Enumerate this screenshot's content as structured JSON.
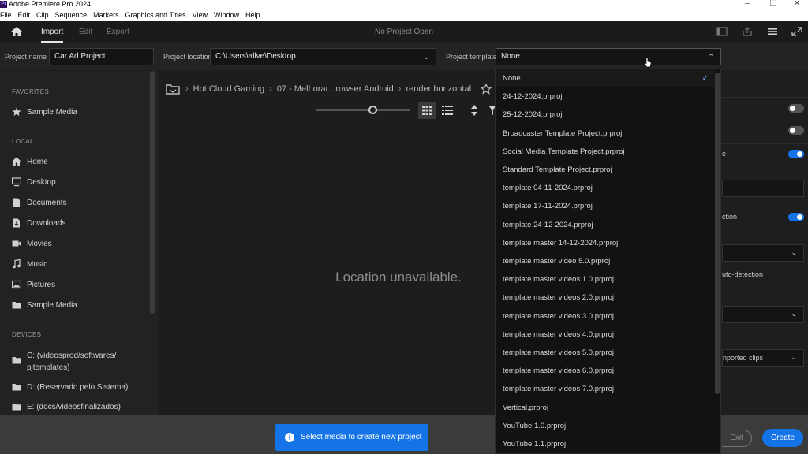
{
  "window": {
    "title": "Adobe Premiere Pro 2024",
    "logo_text": "Pr"
  },
  "menu": [
    "File",
    "Edit",
    "Clip",
    "Sequence",
    "Markers",
    "Graphics and Titles",
    "View",
    "Window",
    "Help"
  ],
  "nav": {
    "tabs": [
      "Import",
      "Edit",
      "Export"
    ],
    "active_tab": "Import",
    "center_text": "No Project Open"
  },
  "settings": {
    "project_name_label": "Project name",
    "project_name_value": "Car Ad Project",
    "project_location_label": "Project location",
    "project_location_value": "C:\\Users\\allve\\Desktop",
    "project_template_label": "Project template",
    "project_template_value": "None"
  },
  "sidebar": {
    "favorites_header": "FAVORITES",
    "favorites": [
      {
        "label": "Sample Media",
        "icon": "star-icon"
      }
    ],
    "local_header": "LOCAL",
    "local": [
      {
        "label": "Home",
        "icon": "home-icon"
      },
      {
        "label": "Desktop",
        "icon": "monitor-icon"
      },
      {
        "label": "Documents",
        "icon": "document-icon"
      },
      {
        "label": "Downloads",
        "icon": "download-icon"
      },
      {
        "label": "Movies",
        "icon": "film-icon"
      },
      {
        "label": "Music",
        "icon": "music-icon"
      },
      {
        "label": "Pictures",
        "icon": "image-icon"
      },
      {
        "label": "Sample Media",
        "icon": "folder-icon"
      }
    ],
    "devices_header": "DEVICES",
    "devices": [
      {
        "label": "C: (videosprod/softwares/",
        "label2": "pjtemplates)",
        "icon": "folder-icon"
      },
      {
        "label": "D: (Reservado pelo Sistema)",
        "icon": "folder-icon"
      },
      {
        "label": "E: (docs/videosfinalizados)",
        "icon": "folder-icon"
      }
    ]
  },
  "browser": {
    "breadcrumb": [
      "Hot Cloud Gaming",
      "07 - Melhorar ..rowser Android",
      "render horizontal"
    ],
    "zoom_level": 0.6,
    "empty_message": "Location unavailable."
  },
  "right_panel": {
    "partial_texts": [
      "e",
      "ction",
      "uto-detection",
      "nported clips"
    ],
    "toggles": [
      false,
      false,
      true,
      true
    ]
  },
  "template_dropdown": {
    "selected": "None",
    "options": [
      "None",
      "24-12-2024.prproj",
      "25-12-2024.prproj",
      "Broadcaster Template Project.prproj",
      "Social Media Template Project.prproj",
      "Standard Template Project.prproj",
      "template 04-11-2024.prproj",
      "template 17-11-2024.prproj",
      "template 24-12-2024.prproj",
      "template master 14-12-2024.prproj",
      "template master video 5.0.prproj",
      "template master videos 1.0.prproj",
      "template master videos 2.0.prproj",
      "template master videos 3.0.prproj",
      "template master videos 4.0.prproj",
      "template master videos 5.0.prproj",
      "template master videos 6.0.prproj",
      "template master videos 7.0.prproj",
      "Vertical.prproj",
      "YouTube 1.0.prproj",
      "YouTube 1.1.prproj"
    ]
  },
  "footer": {
    "toast_text": "Select media to create new project",
    "exit_label": "Exit",
    "create_label": "Create"
  },
  "colors": {
    "accent": "#1473e6",
    "background": "#1d1d1d"
  }
}
